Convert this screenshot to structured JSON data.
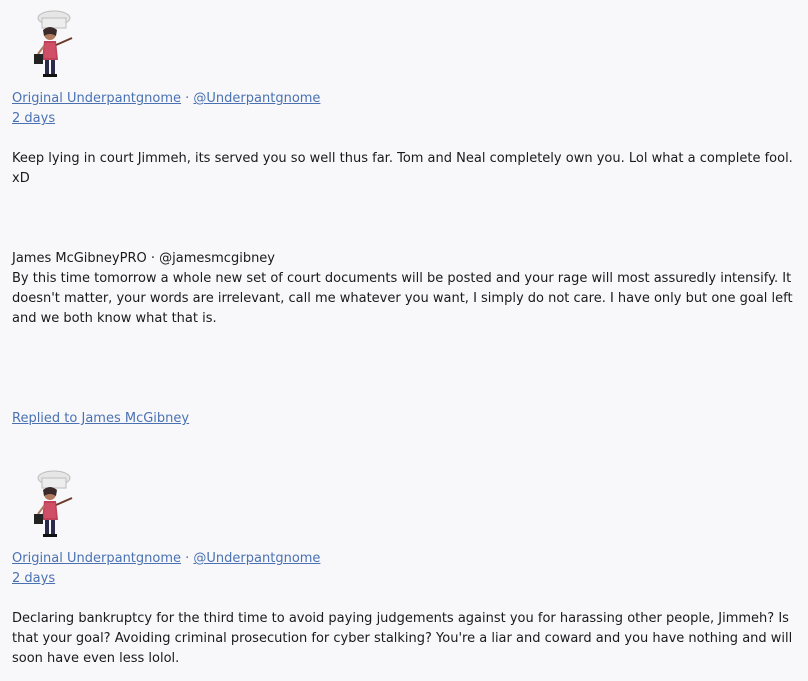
{
  "posts": [
    {
      "author_name": "Original Underpantgnome",
      "separator": " · ",
      "author_handle": "@Underpantgnome",
      "time": "2 days",
      "body": "Keep lying in court Jimmeh, its served you so well thus far. Tom and Neal completely own you. Lol what a complete fool. xD"
    },
    {
      "author_name": "Original Underpantgnome",
      "separator": " · ",
      "author_handle": "@Underpantgnome",
      "time": "2 days",
      "body": "Declaring bankruptcy for the third time to avoid paying judgements against you for harassing other people, Jimmeh? Is that your goal? Avoiding criminal prosecution for cyber stalking? You're a liar and coward and you have nothing and will soon have even less lolol."
    }
  ],
  "quoted": {
    "author_name": "James McGibneyPRO",
    "separator": " · ",
    "author_handle": "@jamesmcgibney",
    "body": "By this time tomorrow a whole new set of court documents will be posted and your rage will most assuredly intensify. It doesn't matter, your words are irrelevant, call me whatever you want, I simply do not care. I have only but one goal left and we both know what that is."
  },
  "reply_link": "Replied to James McGibney",
  "colors": {
    "link": "#4a72b3",
    "background": "#f8f8fa",
    "text": "#1a1a1a"
  }
}
